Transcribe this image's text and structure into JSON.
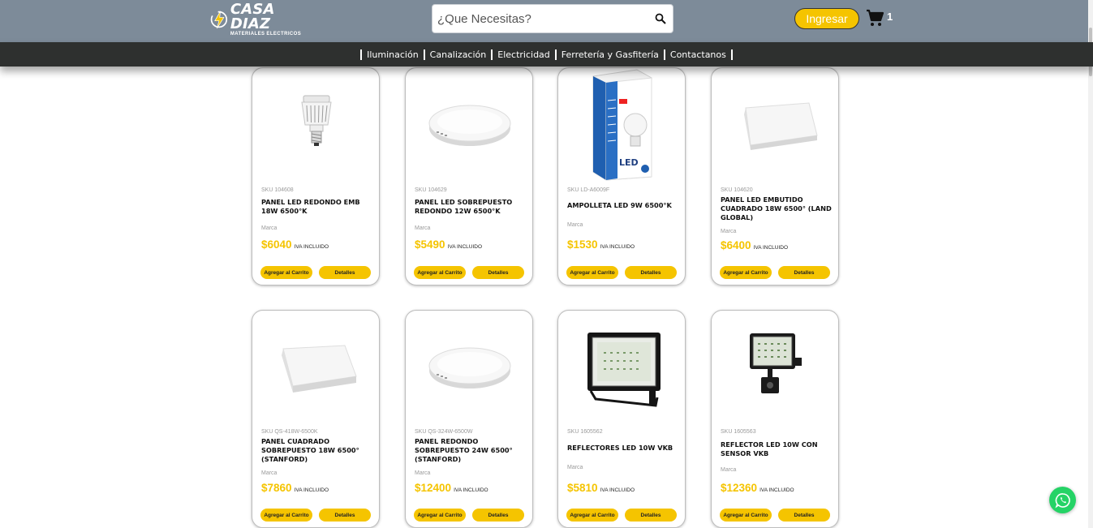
{
  "header": {
    "logo_name": "CASA DIAZ",
    "logo_sub": "MATERIALES ELECTRICOS",
    "search_placeholder": "¿Que Necesitas?",
    "login_label": "Ingresar",
    "cart_count": "1"
  },
  "nav": {
    "items": [
      "Iluminación",
      "Canalización",
      "Electricidad",
      "Ferretería y Gasfitería",
      "Contactanos"
    ]
  },
  "colors": {
    "accent": "#f5c400",
    "header_bg": "#7d8b99",
    "nav_bg": "#2e302f",
    "whatsapp": "#25d366"
  },
  "products": [
    {
      "sku": "SKU 104608",
      "title": "PANEL LED REDONDO EMB 18W 6500°K",
      "brand": "Marca",
      "price": "$6040",
      "iva": "IVA INCLUIDO",
      "add_label": "Agregar al Carrito",
      "details_label": "Detalles",
      "image": "bulb-highbay"
    },
    {
      "sku": "SKU 104629",
      "title": "PANEL LED SOBREPUESTO REDONDO 12W 6500°K",
      "brand": "Marca",
      "price": "$5490",
      "iva": "IVA INCLUIDO",
      "add_label": "Agregar al Carrito",
      "details_label": "Detalles",
      "image": "round-panel"
    },
    {
      "sku": "SKU LD-A6009F",
      "title": "AMPOLLETA LED 9W 6500°K",
      "brand": "Marca",
      "price": "$1530",
      "iva": "IVA INCLUIDO",
      "add_label": "Agregar al Carrito",
      "details_label": "Detalles",
      "image": "bulb-box"
    },
    {
      "sku": "SKU 104620",
      "title": "PANEL LED EMBUTIDO CUADRADO 18W 6500° (LAND GLOBAL)",
      "brand": "Marca",
      "price": "$6400",
      "iva": "IVA INCLUIDO",
      "add_label": "Agregar al Carrito",
      "details_label": "Detalles",
      "image": "square-panel"
    },
    {
      "sku": "SKU QS-418W-6500K",
      "title": "PANEL CUADRADO SOBREPUESTO 18W 6500° (STANFORD)",
      "brand": "Marca",
      "price": "$7860",
      "iva": "IVA INCLUIDO",
      "add_label": "Agregar al Carrito",
      "details_label": "Detalles",
      "image": "square-panel"
    },
    {
      "sku": "SKU QS-324W-6500W",
      "title": "PANEL REDONDO SOBREPUESTO 24W 6500° (STANFORD)",
      "brand": "Marca",
      "price": "$12400",
      "iva": "IVA INCLUIDO",
      "add_label": "Agregar al Carrito",
      "details_label": "Detalles",
      "image": "round-panel"
    },
    {
      "sku": "SKU 1605562",
      "title": "REFLECTORES LED 10W VKB",
      "brand": "Marca",
      "price": "$5810",
      "iva": "IVA INCLUIDO",
      "add_label": "Agregar al Carrito",
      "details_label": "Detalles",
      "image": "floodlight"
    },
    {
      "sku": "SKU 1605563",
      "title": "REFLECTOR LED 10W CON SENSOR VKB",
      "brand": "Marca",
      "price": "$12360",
      "iva": "IVA INCLUIDO",
      "add_label": "Agregar al Carrito",
      "details_label": "Detalles",
      "image": "floodlight-sensor"
    }
  ]
}
